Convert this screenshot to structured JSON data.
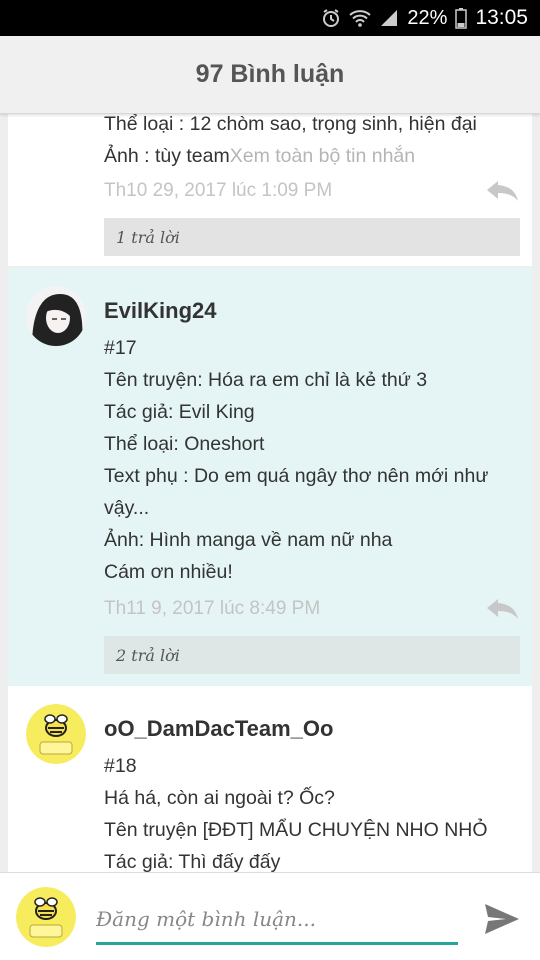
{
  "status_bar": {
    "battery": "22%",
    "time": "13:05",
    "icons": [
      "alarm-icon",
      "wifi-icon",
      "signal-icon",
      "battery-icon"
    ]
  },
  "header": {
    "title": "97 Bình luận"
  },
  "comments": [
    {
      "lines": [
        "Thể loại : 12 chòm sao, trọng sinh, hiện đại"
      ],
      "last_line": "Ảnh : tùy team",
      "see_more": "Xem toàn bộ tin nhắn",
      "timestamp": "Th10 29, 2017 lúc 1:09 PM",
      "replies": "1 trả lời"
    },
    {
      "username": "EvilKing24",
      "number": "#17",
      "lines": [
        "Tên truyện: Hóa ra em chỉ là kẻ thứ 3",
        "Tác giả: Evil King",
        "Thể loại: Oneshort",
        "Text phụ : Do em quá ngây thơ nên mới như vậy...",
        "Ảnh: Hình manga về nam nữ nha",
        "Cám ơn nhiều!"
      ],
      "timestamp": "Th11 9, 2017 lúc 8:49 PM",
      "replies": "2 trả lời",
      "avatar_icon": "anime-girl-avatar"
    },
    {
      "username": "oO_DamDacTeam_Oo",
      "number": "#18",
      "lines": [
        "Há há, còn ai ngoài t? Ốc?",
        "Tên truyện [ĐĐT] MẨU CHUYỆN NHO NHỎ",
        "Tác giả: Thì đấy đấy"
      ],
      "avatar_icon": "bee-logo-avatar"
    }
  ],
  "composer": {
    "placeholder": "Đăng một bình luận...",
    "avatar_icon": "bee-logo-avatar",
    "send_icon": "send-icon"
  },
  "colors": {
    "accent": "#26a69a",
    "highlight_bg": "#e5f5f5",
    "timestamp": "#c4c4c4"
  }
}
